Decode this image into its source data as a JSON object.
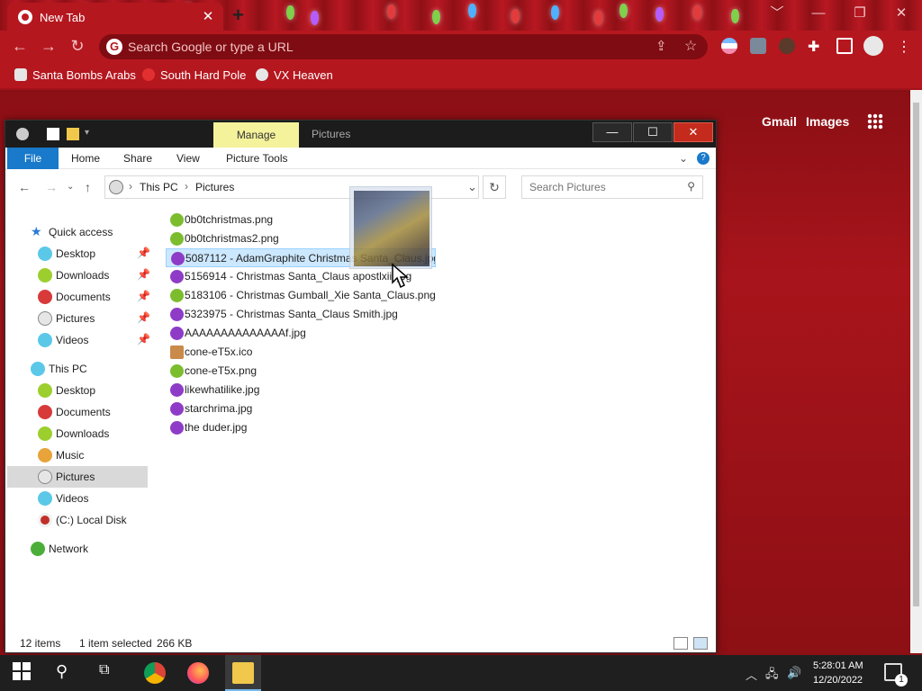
{
  "browser": {
    "tab_title": "New Tab",
    "tab_close": "✕",
    "new_tab": "+",
    "omnibox_placeholder": "Search Google or type a URL",
    "window_controls": [
      "﹀",
      "—",
      "❐",
      "✕"
    ],
    "bookmarks": [
      {
        "label": "Santa Bombs Arabs",
        "icon": "rocket-icon",
        "color": "#e6e6e6"
      },
      {
        "label": "South Hard Pole",
        "icon": "snowflake-icon",
        "color": "#e23030"
      },
      {
        "label": "VX Heaven",
        "icon": "skull-icon",
        "color": "#e6e6e6"
      }
    ],
    "google_links": [
      "Gmail",
      "Images"
    ]
  },
  "explorer": {
    "title": "Pictures",
    "manage_tab": "Manage",
    "window_buttons": [
      "—",
      "☐",
      "✕"
    ],
    "ribbon_tabs": [
      "File",
      "Home",
      "Share",
      "View",
      "Picture Tools"
    ],
    "breadcrumb": [
      "This PC",
      "Pictures"
    ],
    "search_placeholder": "Search Pictures",
    "nav": {
      "quick_access": "Quick access",
      "quick_items": [
        "Desktop",
        "Downloads",
        "Documents",
        "Pictures",
        "Videos"
      ],
      "this_pc": "This PC",
      "pc_items": [
        "Desktop",
        "Documents",
        "Downloads",
        "Music",
        "Pictures",
        "Videos",
        "(C:) Local Disk"
      ],
      "network": "Network"
    },
    "files": [
      {
        "name": "0b0tchristmas.png",
        "icon": "green-ornament-icon",
        "color": "#7cbd2e"
      },
      {
        "name": "0b0tchristmas2.png",
        "icon": "green-ornament-icon",
        "color": "#7cbd2e"
      },
      {
        "name": "5087112 - AdamGraphite Christmas Santa_Claus.jpg",
        "icon": "purple-ornament-icon",
        "color": "#8e3cc8"
      },
      {
        "name": "5156914 - Christmas Santa_Claus apostlxiii.jpg",
        "icon": "purple-ornament-icon",
        "color": "#8e3cc8"
      },
      {
        "name": "5183106 - Christmas Gumball_Xie Santa_Claus.png",
        "icon": "green-ornament-icon",
        "color": "#7cbd2e"
      },
      {
        "name": "5323975 - Christmas Santa_Claus Smith.jpg",
        "icon": "purple-ornament-icon",
        "color": "#8e3cc8"
      },
      {
        "name": "AAAAAAAAAAAAAAf.jpg",
        "icon": "purple-ornament-icon",
        "color": "#8e3cc8"
      },
      {
        "name": "cone-eT5x.ico",
        "icon": "cone-icon",
        "color": "#c98a4a"
      },
      {
        "name": "cone-eT5x.png",
        "icon": "green-ornament-icon",
        "color": "#7cbd2e"
      },
      {
        "name": "likewhatilike.jpg",
        "icon": "purple-ornament-icon",
        "color": "#8e3cc8"
      },
      {
        "name": "starchrima.jpg",
        "icon": "purple-ornament-icon",
        "color": "#8e3cc8"
      },
      {
        "name": "the duder.jpg",
        "icon": "purple-ornament-icon",
        "color": "#8e3cc8"
      }
    ],
    "status": {
      "count": "12 items",
      "selected": "1 item selected",
      "size": "266 KB"
    }
  },
  "taskbar": {
    "clock_time": "5:28:01 AM",
    "clock_date": "12/20/2022",
    "notification_count": "1"
  }
}
